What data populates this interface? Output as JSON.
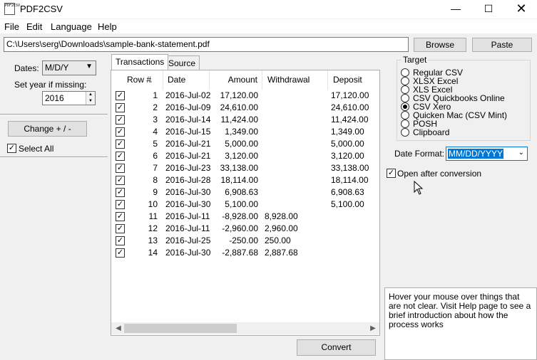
{
  "window": {
    "app_icon_text": "PDF2CSV",
    "title": "PDF2CSV",
    "minimize_glyph": "—",
    "maximize_glyph": "☐",
    "close_glyph": "✕"
  },
  "menu": [
    "File",
    "Edit",
    "Language",
    "Help"
  ],
  "file_bar": {
    "path": "C:\\Users\\serg\\Downloads\\sample-bank-statement.pdf",
    "browse_label": "Browse",
    "paste_label": "Paste"
  },
  "left_panel": {
    "dates_label": "Dates:",
    "dates_value": "M/D/Y",
    "year_label": "Set year if missing:",
    "year_value": "2016",
    "change_button": "Change + / -",
    "select_all_label": "Select All",
    "select_all_checked": true
  },
  "tabs": [
    {
      "label": "Transactions",
      "active": true
    },
    {
      "label": "Source",
      "active": false
    }
  ],
  "table": {
    "columns": [
      "Row #",
      "Date",
      "Amount",
      "Withdrawal",
      "Deposit"
    ],
    "rows": [
      {
        "checked": true,
        "row": "1",
        "date": "2016-Jul-02",
        "amount": "17,120.00",
        "withdrawal": "",
        "deposit": "17,120.00"
      },
      {
        "checked": true,
        "row": "2",
        "date": "2016-Jul-09",
        "amount": "24,610.00",
        "withdrawal": "",
        "deposit": "24,610.00"
      },
      {
        "checked": true,
        "row": "3",
        "date": "2016-Jul-14",
        "amount": "11,424.00",
        "withdrawal": "",
        "deposit": "11,424.00"
      },
      {
        "checked": true,
        "row": "4",
        "date": "2016-Jul-15",
        "amount": "1,349.00",
        "withdrawal": "",
        "deposit": "1,349.00"
      },
      {
        "checked": true,
        "row": "5",
        "date": "2016-Jul-21",
        "amount": "5,000.00",
        "withdrawal": "",
        "deposit": "5,000.00"
      },
      {
        "checked": true,
        "row": "6",
        "date": "2016-Jul-21",
        "amount": "3,120.00",
        "withdrawal": "",
        "deposit": "3,120.00"
      },
      {
        "checked": true,
        "row": "7",
        "date": "2016-Jul-23",
        "amount": "33,138.00",
        "withdrawal": "",
        "deposit": "33,138.00"
      },
      {
        "checked": true,
        "row": "8",
        "date": "2016-Jul-28",
        "amount": "18,114.00",
        "withdrawal": "",
        "deposit": "18,114.00"
      },
      {
        "checked": true,
        "row": "9",
        "date": "2016-Jul-30",
        "amount": "6,908.63",
        "withdrawal": "",
        "deposit": "6,908.63"
      },
      {
        "checked": true,
        "row": "10",
        "date": "2016-Jul-30",
        "amount": "5,100.00",
        "withdrawal": "",
        "deposit": "5,100.00"
      },
      {
        "checked": true,
        "row": "11",
        "date": "2016-Jul-11",
        "amount": "-8,928.00",
        "withdrawal": "8,928.00",
        "deposit": ""
      },
      {
        "checked": true,
        "row": "12",
        "date": "2016-Jul-11",
        "amount": "-2,960.00",
        "withdrawal": "2,960.00",
        "deposit": ""
      },
      {
        "checked": true,
        "row": "13",
        "date": "2016-Jul-25",
        "amount": "-250.00",
        "withdrawal": "250.00",
        "deposit": ""
      },
      {
        "checked": true,
        "row": "14",
        "date": "2016-Jul-30",
        "amount": "-2,887.68",
        "withdrawal": "2,887.68",
        "deposit": ""
      }
    ]
  },
  "convert_label": "Convert",
  "target": {
    "title": "Target",
    "options": [
      "Regular CSV",
      "XLSX Excel",
      "XLS Excel",
      "CSV Quickbooks Online",
      "CSV Xero",
      "Quicken Mac (CSV Mint)",
      "POSH",
      "Clipboard"
    ],
    "selected": "CSV Xero"
  },
  "date_format": {
    "label": "Date Format:",
    "value": "MM/DD/YYYY"
  },
  "open_after": {
    "label": "Open after conversion",
    "checked": true
  },
  "help_text": "Hover your mouse over things that are not clear. Visit Help page to see a brief introduction about how the process works"
}
